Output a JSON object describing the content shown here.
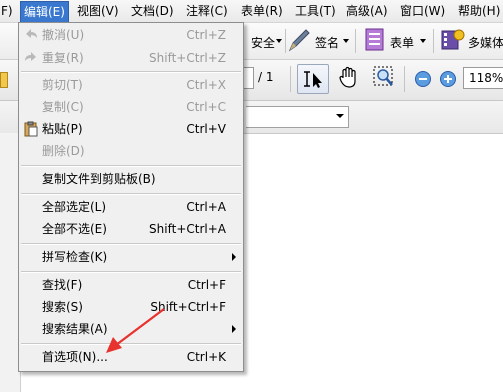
{
  "menubar": {
    "items": [
      "F)",
      "编辑(E)",
      "视图(V)",
      "文档(D)",
      "注释(C)",
      "表单(R)",
      "工具(T)",
      "高级(A)",
      "窗口(W)",
      "帮助(H)"
    ]
  },
  "toolbar1": {
    "security_label": "安全",
    "sign_label": "签名",
    "forms_label": "表单",
    "multimedia_label": "多媒体"
  },
  "toolbar2": {
    "page_total": "/ 1",
    "zoom_value": "118%"
  },
  "edit_menu": {
    "items": [
      {
        "label": "撤消(U)",
        "shortcut": "Ctrl+Z",
        "disabled": true
      },
      {
        "label": "重复(R)",
        "shortcut": "Shift+Ctrl+Z",
        "disabled": true
      },
      {
        "label": "剪切(T)",
        "shortcut": "Ctrl+X",
        "disabled": true
      },
      {
        "label": "复制(C)",
        "shortcut": "Ctrl+C",
        "disabled": true
      },
      {
        "label": "粘贴(P)",
        "shortcut": "Ctrl+V",
        "disabled": false
      },
      {
        "label": "删除(D)",
        "shortcut": "",
        "disabled": true
      },
      {
        "label": "复制文件到剪贴板(B)",
        "shortcut": "",
        "disabled": false
      },
      {
        "label": "全部选定(L)",
        "shortcut": "Ctrl+A",
        "disabled": false
      },
      {
        "label": "全部不选(E)",
        "shortcut": "Shift+Ctrl+A",
        "disabled": false
      },
      {
        "label": "拼写检查(K)",
        "shortcut": "",
        "disabled": false,
        "submenu": true
      },
      {
        "label": "查找(F)",
        "shortcut": "Ctrl+F",
        "disabled": false
      },
      {
        "label": "搜索(S)",
        "shortcut": "Shift+Ctrl+F",
        "disabled": false
      },
      {
        "label": "搜索结果(A)",
        "shortcut": "",
        "disabled": false,
        "submenu": true
      },
      {
        "label": "首选项(N)...",
        "shortcut": "Ctrl+K",
        "disabled": false
      }
    ]
  },
  "colors": {
    "menu_highlight": "#3a78d0",
    "annotation_arrow": "#e8322e"
  },
  "icons": {
    "undo": "undo-icon",
    "redo": "redo-icon",
    "paste": "paste-icon",
    "hand": "hand-tool-icon",
    "select": "select-text-icon",
    "zoom_out": "zoom-out-icon",
    "zoom_in": "zoom-in-icon",
    "sign": "pen-icon",
    "forms": "form-icon",
    "multimedia": "multimedia-icon"
  }
}
